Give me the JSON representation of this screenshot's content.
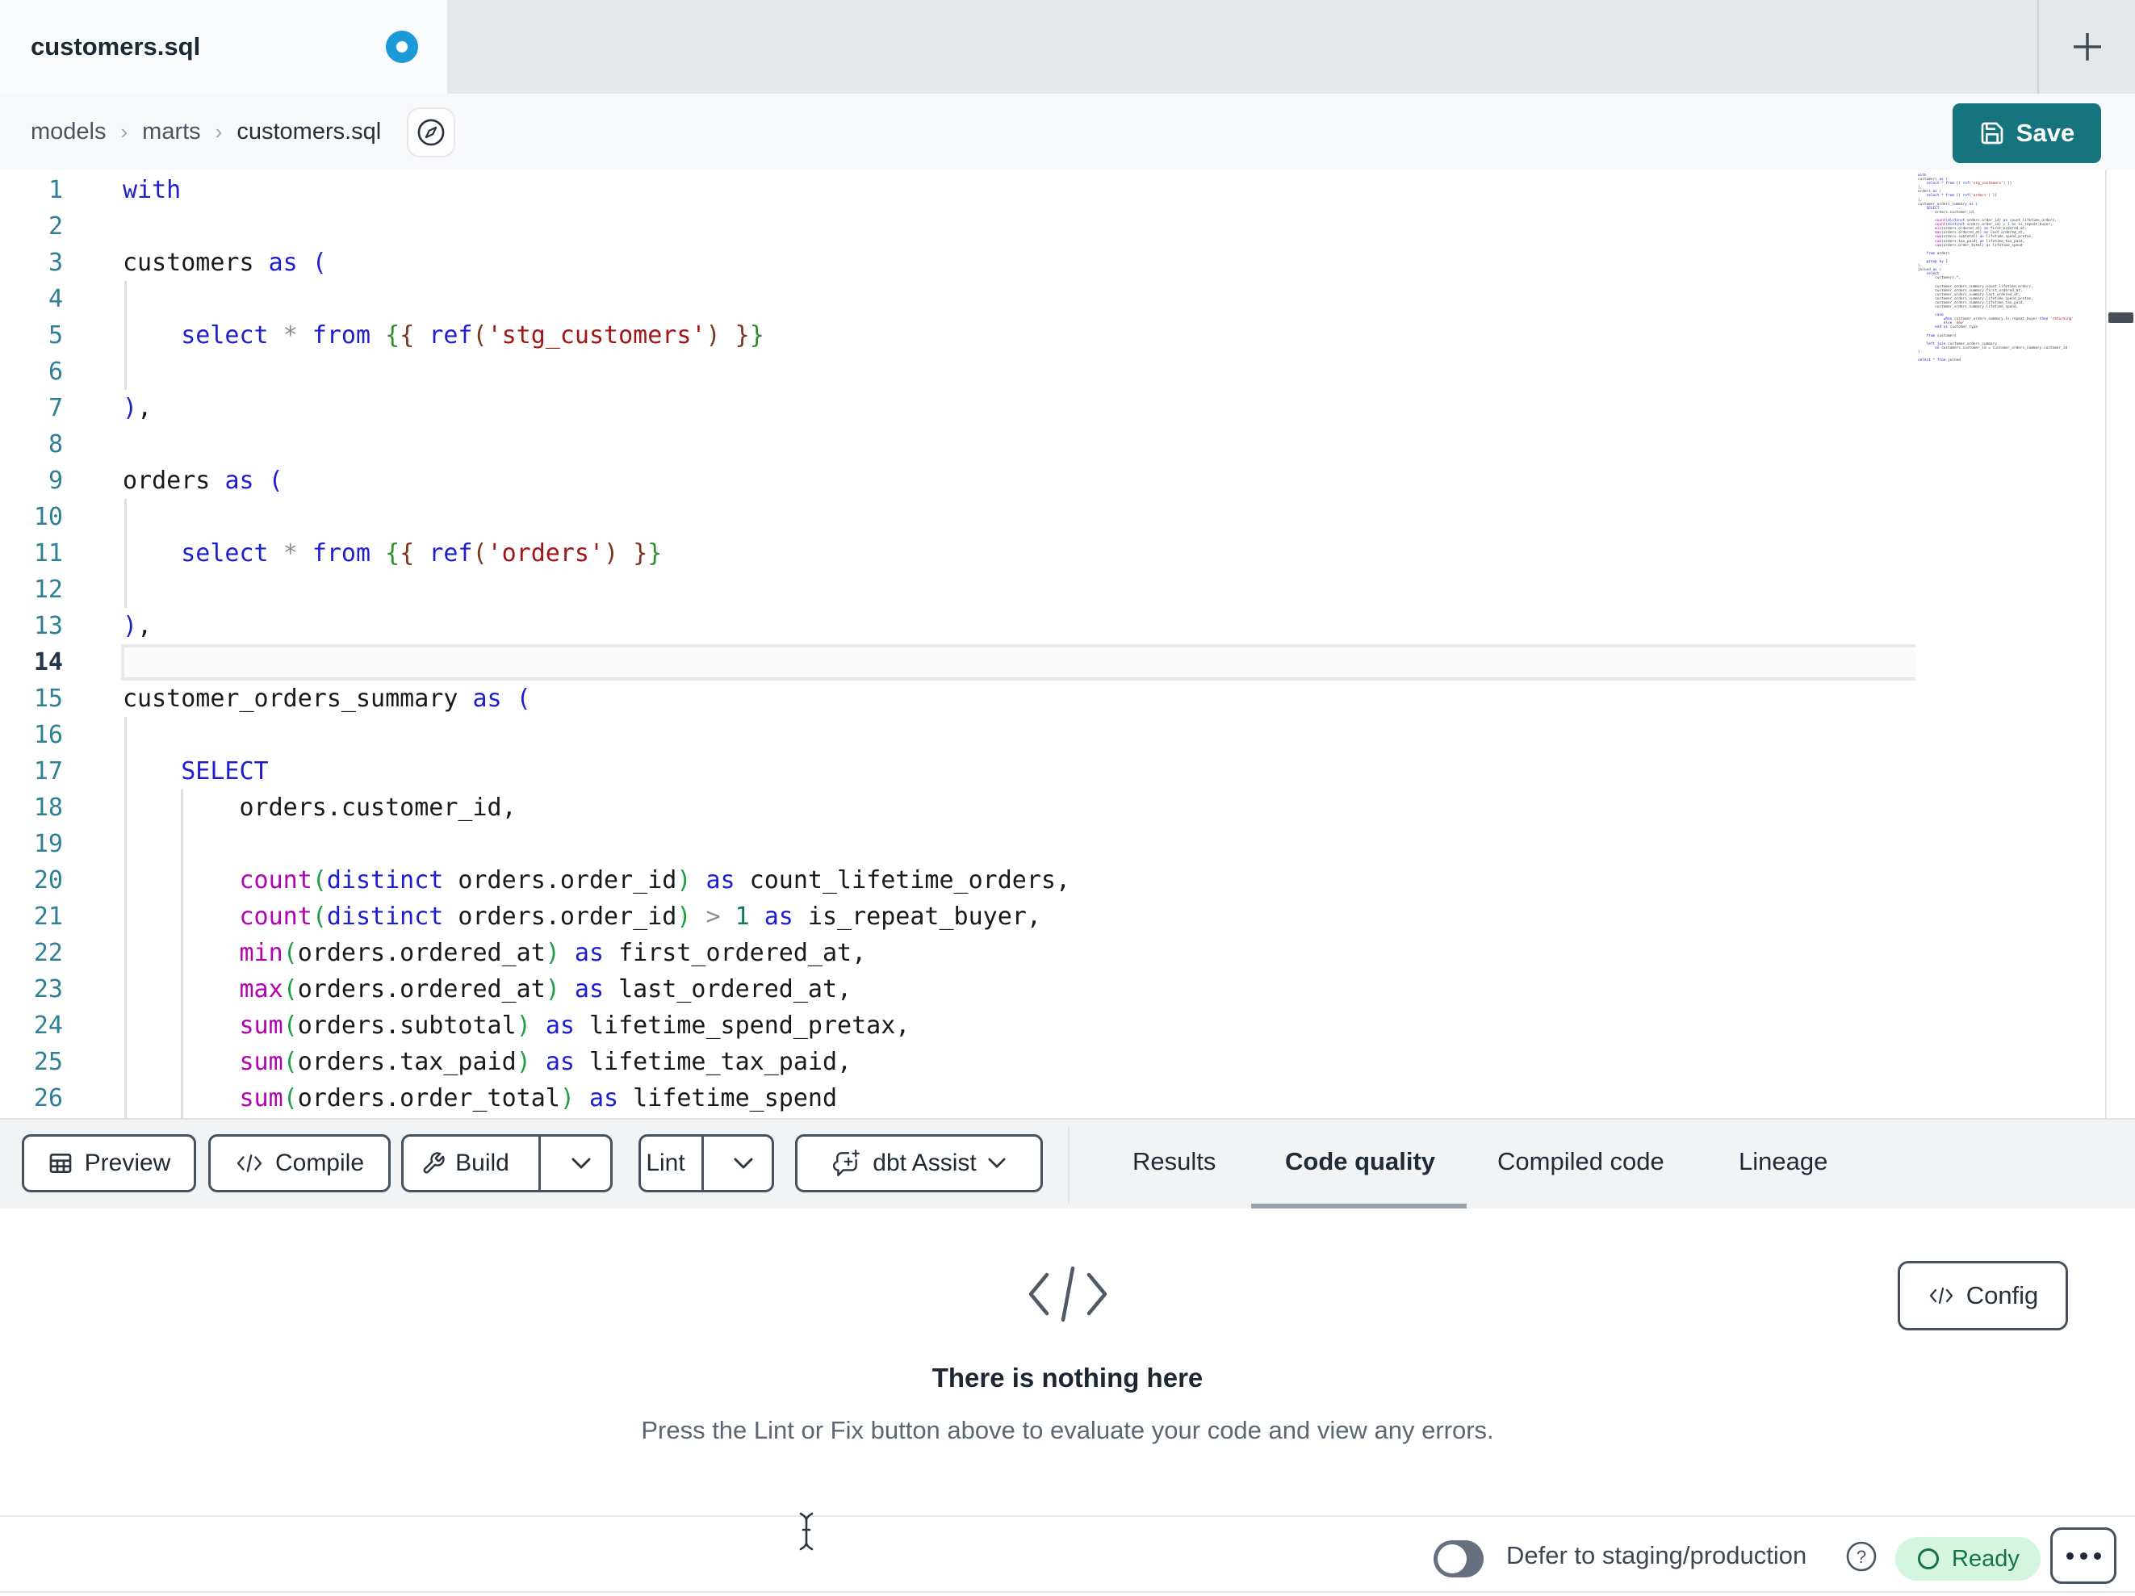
{
  "window": {
    "tab_title": "customers.sql",
    "unsaved_indicator": true,
    "new_tab_label": "+"
  },
  "breadcrumb": {
    "items": [
      "models",
      "marts",
      "customers.sql"
    ],
    "separator": "›"
  },
  "save": {
    "label": "Save"
  },
  "editor": {
    "active_line": 14,
    "lines": [
      {
        "n": 1,
        "s": [
          [
            "kw",
            "with"
          ]
        ]
      },
      {
        "n": 2,
        "s": []
      },
      {
        "n": 3,
        "s": [
          [
            "pl",
            "customers "
          ],
          [
            "kw",
            "as ("
          ]
        ]
      },
      {
        "n": 4,
        "s": []
      },
      {
        "n": 5,
        "s": [
          [
            "pl",
            "    "
          ],
          [
            "kw",
            "select"
          ],
          [
            "pl",
            " "
          ],
          [
            "op",
            "*"
          ],
          [
            "pl",
            " "
          ],
          [
            "kw",
            "from"
          ],
          [
            "pl",
            " "
          ],
          [
            "jg",
            "{"
          ],
          [
            "jx",
            "{"
          ],
          [
            "pl",
            " "
          ],
          [
            "kw",
            "ref"
          ],
          [
            "jx",
            "("
          ],
          [
            "str",
            "'stg_customers'"
          ],
          [
            "jx",
            ")"
          ],
          [
            "pl",
            " "
          ],
          [
            "jx",
            "}"
          ],
          [
            "jg",
            "}"
          ]
        ]
      },
      {
        "n": 6,
        "s": []
      },
      {
        "n": 7,
        "s": [
          [
            "kw",
            ")"
          ],
          [
            "pl",
            ","
          ]
        ]
      },
      {
        "n": 8,
        "s": []
      },
      {
        "n": 9,
        "s": [
          [
            "pl",
            "orders "
          ],
          [
            "kw",
            "as ("
          ]
        ]
      },
      {
        "n": 10,
        "s": []
      },
      {
        "n": 11,
        "s": [
          [
            "pl",
            "    "
          ],
          [
            "kw",
            "select"
          ],
          [
            "pl",
            " "
          ],
          [
            "op",
            "*"
          ],
          [
            "pl",
            " "
          ],
          [
            "kw",
            "from"
          ],
          [
            "pl",
            " "
          ],
          [
            "jg",
            "{"
          ],
          [
            "jx",
            "{"
          ],
          [
            "pl",
            " "
          ],
          [
            "kw",
            "ref"
          ],
          [
            "jx",
            "("
          ],
          [
            "str",
            "'orders'"
          ],
          [
            "jx",
            ")"
          ],
          [
            "pl",
            " "
          ],
          [
            "jx",
            "}"
          ],
          [
            "jg",
            "}"
          ]
        ]
      },
      {
        "n": 12,
        "s": []
      },
      {
        "n": 13,
        "s": [
          [
            "kw",
            ")"
          ],
          [
            "pl",
            ","
          ]
        ]
      },
      {
        "n": 14,
        "s": []
      },
      {
        "n": 15,
        "s": [
          [
            "pl",
            "customer_orders_summary "
          ],
          [
            "kw",
            "as ("
          ]
        ]
      },
      {
        "n": 16,
        "s": []
      },
      {
        "n": 17,
        "s": [
          [
            "pl",
            "    "
          ],
          [
            "kw",
            "SELECT"
          ]
        ]
      },
      {
        "n": 18,
        "s": [
          [
            "pl",
            "        orders.customer_id,"
          ]
        ]
      },
      {
        "n": 19,
        "s": []
      },
      {
        "n": 20,
        "s": [
          [
            "pl",
            "        "
          ],
          [
            "fn",
            "count"
          ],
          [
            "br",
            "("
          ],
          [
            "kw",
            "distinct"
          ],
          [
            "pl",
            " orders.order_id"
          ],
          [
            "br",
            ")"
          ],
          [
            "pl",
            " "
          ],
          [
            "kw",
            "as"
          ],
          [
            "pl",
            " count_lifetime_orders,"
          ]
        ]
      },
      {
        "n": 21,
        "s": [
          [
            "pl",
            "        "
          ],
          [
            "fn",
            "count"
          ],
          [
            "br",
            "("
          ],
          [
            "kw",
            "distinct"
          ],
          [
            "pl",
            " orders.order_id"
          ],
          [
            "br",
            ")"
          ],
          [
            "pl",
            " "
          ],
          [
            "op",
            ">"
          ],
          [
            "pl",
            " "
          ],
          [
            "num",
            "1"
          ],
          [
            "pl",
            " "
          ],
          [
            "kw",
            "as"
          ],
          [
            "pl",
            " is_repeat_buyer,"
          ]
        ]
      },
      {
        "n": 22,
        "s": [
          [
            "pl",
            "        "
          ],
          [
            "fn",
            "min"
          ],
          [
            "br",
            "("
          ],
          [
            "pl",
            "orders.ordered_at"
          ],
          [
            "br",
            ")"
          ],
          [
            "pl",
            " "
          ],
          [
            "kw",
            "as"
          ],
          [
            "pl",
            " first_ordered_at,"
          ]
        ]
      },
      {
        "n": 23,
        "s": [
          [
            "pl",
            "        "
          ],
          [
            "fn",
            "max"
          ],
          [
            "br",
            "("
          ],
          [
            "pl",
            "orders.ordered_at"
          ],
          [
            "br",
            ")"
          ],
          [
            "pl",
            " "
          ],
          [
            "kw",
            "as"
          ],
          [
            "pl",
            " last_ordered_at,"
          ]
        ]
      },
      {
        "n": 24,
        "s": [
          [
            "pl",
            "        "
          ],
          [
            "fn",
            "sum"
          ],
          [
            "br",
            "("
          ],
          [
            "pl",
            "orders.subtotal"
          ],
          [
            "br",
            ")"
          ],
          [
            "pl",
            " "
          ],
          [
            "kw",
            "as"
          ],
          [
            "pl",
            " lifetime_spend_pretax,"
          ]
        ]
      },
      {
        "n": 25,
        "s": [
          [
            "pl",
            "        "
          ],
          [
            "fn",
            "sum"
          ],
          [
            "br",
            "("
          ],
          [
            "pl",
            "orders.tax_paid"
          ],
          [
            "br",
            ")"
          ],
          [
            "pl",
            " "
          ],
          [
            "kw",
            "as"
          ],
          [
            "pl",
            " lifetime_tax_paid,"
          ]
        ]
      },
      {
        "n": 26,
        "s": [
          [
            "pl",
            "        "
          ],
          [
            "fn",
            "sum"
          ],
          [
            "br",
            "("
          ],
          [
            "pl",
            "orders.order_total"
          ],
          [
            "br",
            ")"
          ],
          [
            "pl",
            " "
          ],
          [
            "kw",
            "as"
          ],
          [
            "pl",
            " lifetime_spend"
          ]
        ]
      }
    ],
    "minimap_lines": [
      "with",
      "customers as (",
      "    select * from {{ ref('stg_customers') }}",
      "),",
      "orders as (",
      "    select * from {{ ref('orders') }}",
      "),",
      "customer_orders_summary as (",
      "    SELECT",
      "        orders.customer_id,",
      "",
      "        count(distinct orders.order_id) as count_lifetime_orders,",
      "        count(distinct orders.order_id) > 1 as is_repeat_buyer,",
      "        min(orders.ordered_at) as first_ordered_at,",
      "        max(orders.ordered_at) as last_ordered_at,",
      "        sum(orders.subtotal) as lifetime_spend_pretax,",
      "        sum(orders.tax_paid) as lifetime_tax_paid,",
      "        sum(orders.order_total) as lifetime_spend",
      "",
      "    from orders",
      "",
      "    group by 1",
      "),",
      "joined as (",
      "    select",
      "        customers.*,",
      "",
      "        customer_orders_summary.count_lifetime_orders,",
      "        customer_orders_summary.first_ordered_at,",
      "        customer_orders_summary.last_ordered_at,",
      "        customer_orders_summary.lifetime_spend_pretax,",
      "        customer_orders_summary.lifetime_tax_paid,",
      "        customer_orders_summary.lifetime_spend,",
      "",
      "        case",
      "            when customer_orders_summary.is_repeat_buyer then 'returning'",
      "            else 'new'",
      "        end as customer_type",
      "",
      "    from customers",
      "",
      "    left join customer_orders_summary",
      "        on customers.customer_id = customer_orders_summary.customer_id",
      ")",
      "",
      "select * from joined"
    ]
  },
  "toolbar": {
    "preview_label": "Preview",
    "compile_label": "Compile",
    "build_label": "Build",
    "lint_label": "Lint",
    "assist_label": "dbt Assist"
  },
  "result_tabs": [
    {
      "label": "Results",
      "active": false
    },
    {
      "label": "Code quality",
      "active": true
    },
    {
      "label": "Compiled code",
      "active": false
    },
    {
      "label": "Lineage",
      "active": false
    }
  ],
  "results_panel": {
    "config_label": "Config",
    "empty_title": "There is nothing here",
    "empty_subtitle": "Press the Lint or Fix button above to evaluate your code and view any errors."
  },
  "statusbar": {
    "defer_label": "Defer to staging/production",
    "ready_label": "Ready",
    "toggle_on": false
  },
  "colors": {
    "accent_teal": "#15747e",
    "unsaved_dot_blue": "#1b9ad8",
    "ready_badge_bg": "#d6f5e1",
    "ready_badge_text": "#157347",
    "keyword_blue": "#1d1dd1",
    "string_red": "#a31515",
    "function_magenta": "#b202b2",
    "line_number_teal": "#2f7f95"
  }
}
